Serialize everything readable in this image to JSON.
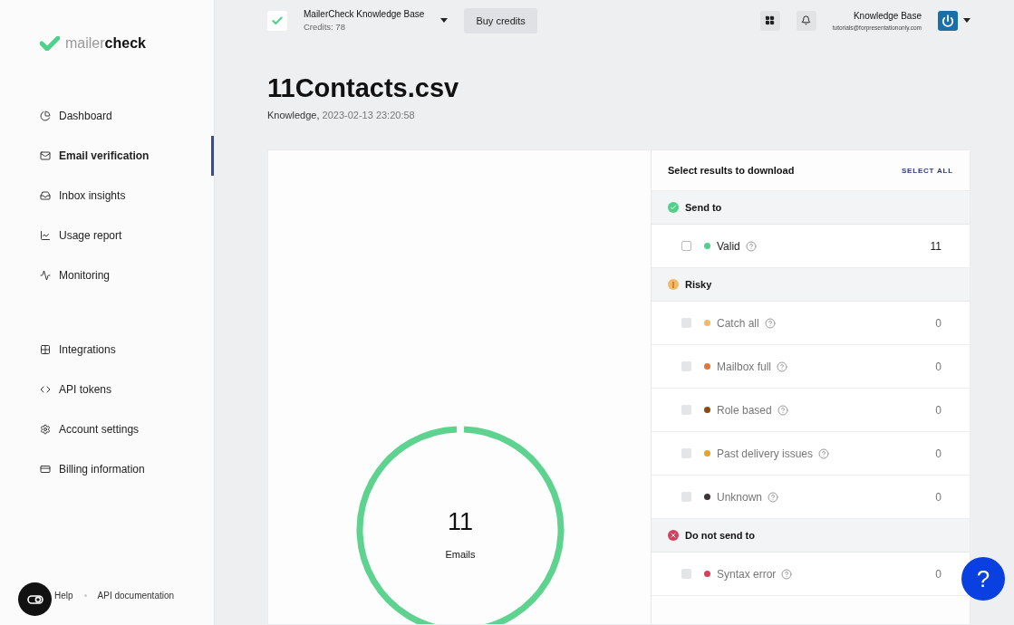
{
  "brand": {
    "name_light": "mailer",
    "name_bold": "check"
  },
  "sidebar": {
    "main_items": [
      {
        "label": "Dashboard",
        "selected": false
      },
      {
        "label": "Email verification",
        "selected": true
      },
      {
        "label": "Inbox insights",
        "selected": false
      },
      {
        "label": "Usage report",
        "selected": false
      },
      {
        "label": "Monitoring",
        "selected": false
      }
    ],
    "settings_items": [
      {
        "label": "Integrations",
        "selected": false
      },
      {
        "label": "API tokens",
        "selected": false
      },
      {
        "label": "Account settings",
        "selected": false
      },
      {
        "label": "Billing information",
        "selected": false
      }
    ],
    "footer_links": [
      "Help",
      "API documentation"
    ]
  },
  "topbar": {
    "account": "MailerCheck Knowledge Base",
    "credits": "Credits: 78",
    "buy_button": "Buy credits",
    "user_name": "Knowledge Base",
    "user_email": "tutorials@forpresentationonly.com"
  },
  "page": {
    "title": "11Contacts.csv",
    "owner": "Knowledge,",
    "date": "2023-02-13 23:20:58"
  },
  "summary": {
    "count": "11",
    "label": "Emails"
  },
  "results": {
    "title": "Select results to download",
    "select_all": "SELECT ALL",
    "groups": [
      {
        "label": "Send to",
        "kind": "ok",
        "rows": [
          {
            "label": "Valid",
            "count": "11",
            "color": "#4fd18b",
            "checked": false,
            "disabled": false
          }
        ]
      },
      {
        "label": "Risky",
        "kind": "warn",
        "rows": [
          {
            "label": "Catch all",
            "count": "0",
            "color": "#f2b96b",
            "checked": false,
            "disabled": true
          },
          {
            "label": "Mailbox full",
            "count": "0",
            "color": "#e0763a",
            "checked": false,
            "disabled": true
          },
          {
            "label": "Role based",
            "count": "0",
            "color": "#8a4a12",
            "checked": false,
            "disabled": true
          },
          {
            "label": "Past delivery issues",
            "count": "0",
            "color": "#e6a22a",
            "checked": false,
            "disabled": true
          },
          {
            "label": "Unknown",
            "count": "0",
            "color": "#3d3438",
            "checked": false,
            "disabled": true
          }
        ]
      },
      {
        "label": "Do not send to",
        "kind": "bad",
        "rows": [
          {
            "label": "Syntax error",
            "count": "0",
            "color": "#d6405a",
            "checked": false,
            "disabled": true
          }
        ]
      }
    ]
  },
  "help_button": "?"
}
